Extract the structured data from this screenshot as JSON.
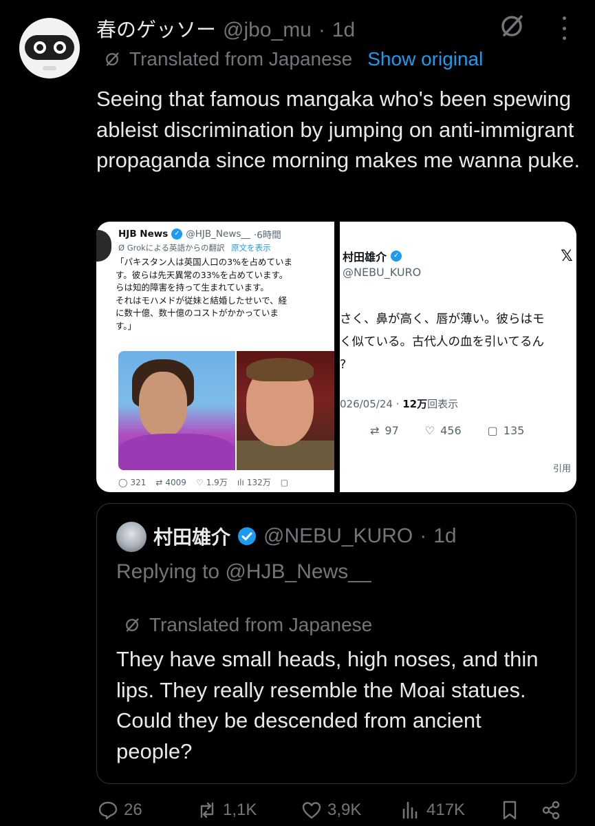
{
  "post": {
    "display_name": "春のゲッソー",
    "handle": "@jbo_mu",
    "dot": "·",
    "time": "1d",
    "translated_label": "Translated from Japanese",
    "show_original": "Show original",
    "text": "Seeing that famous mangaka who's been spewing ableist discrimination by jumping on anti-immigrant propaganda since morning makes me wanna puke."
  },
  "media_left": {
    "name": "HJB News",
    "handle": "@HJB_News__",
    "time": "·6時間",
    "translated": "Grokによる英語からの翻訳",
    "show_original": "原文を表示",
    "body": "「パキスタン人は英国人口の3%を占めていま\nす。彼らは先天異常の33%を占めています。\nらは知的障害を持って生まれています。\nそれはモハメドが従妹と結婚したせいで、経\nに数十億、数十億のコストがかかっていま\nす。」",
    "stats": {
      "replies": "321",
      "reposts": "4009",
      "likes": "1.9万",
      "views": "132万"
    }
  },
  "media_right": {
    "name": "村田雄介",
    "handle": "@NEBU_KURO",
    "x_logo": "𝕏",
    "body": "さく、鼻が高く、唇が薄い。彼らはモ\nく似ている。古代人の血を引いてるん\n?",
    "date": "026/05/24 · ",
    "views": "12万",
    "views_suffix": "回表示",
    "stats": {
      "reposts": "97",
      "likes": "456",
      "bookmarks": "135"
    },
    "quote": "引用"
  },
  "quoted": {
    "name": "村田雄介",
    "handle": "@NEBU_KURO",
    "dot": "·",
    "time": "1d",
    "replying_to": "Replying to @HJB_News__",
    "translated_label": "Translated from Japanese",
    "text": "They have small heads, high noses, and thin lips. They really resemble the Moai statues. Could they be descended from ancient people?"
  },
  "actions": {
    "replies": "26",
    "reposts": "1,1K",
    "likes": "3,9K",
    "views": "417K"
  },
  "colors": {
    "background": "#000000",
    "text": "#e7e9ea",
    "muted": "#71767b",
    "accent": "#1d9bf0",
    "border": "#2f3336"
  },
  "icons": [
    "grok-icon",
    "more-icon",
    "verified-icon",
    "reply-icon",
    "repost-icon",
    "like-icon",
    "views-icon",
    "bookmark-icon",
    "share-icon"
  ]
}
